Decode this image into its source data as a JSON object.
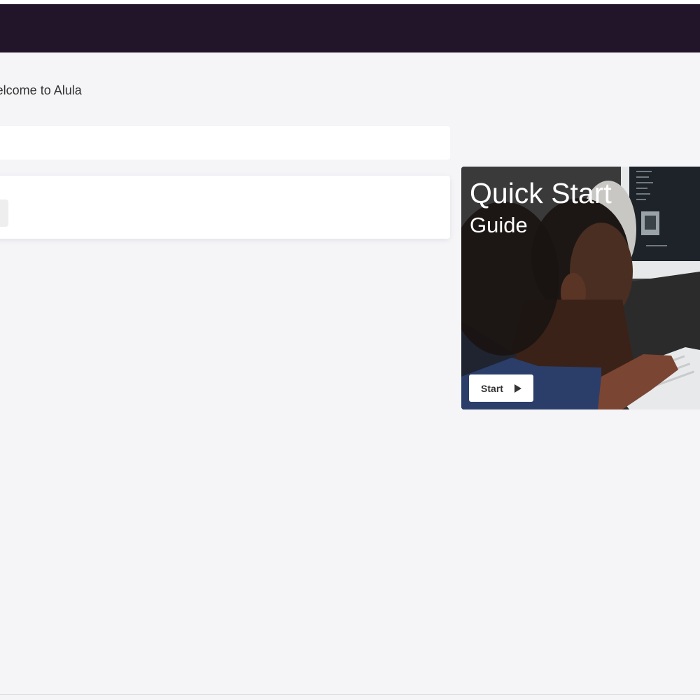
{
  "header": {
    "background": "#221429"
  },
  "main": {
    "welcome_text": "Welcome to Alula"
  },
  "quick_start": {
    "title": "Quick Start",
    "subtitle": "Guide",
    "button_label": "Start",
    "button_icon": "play-icon"
  }
}
